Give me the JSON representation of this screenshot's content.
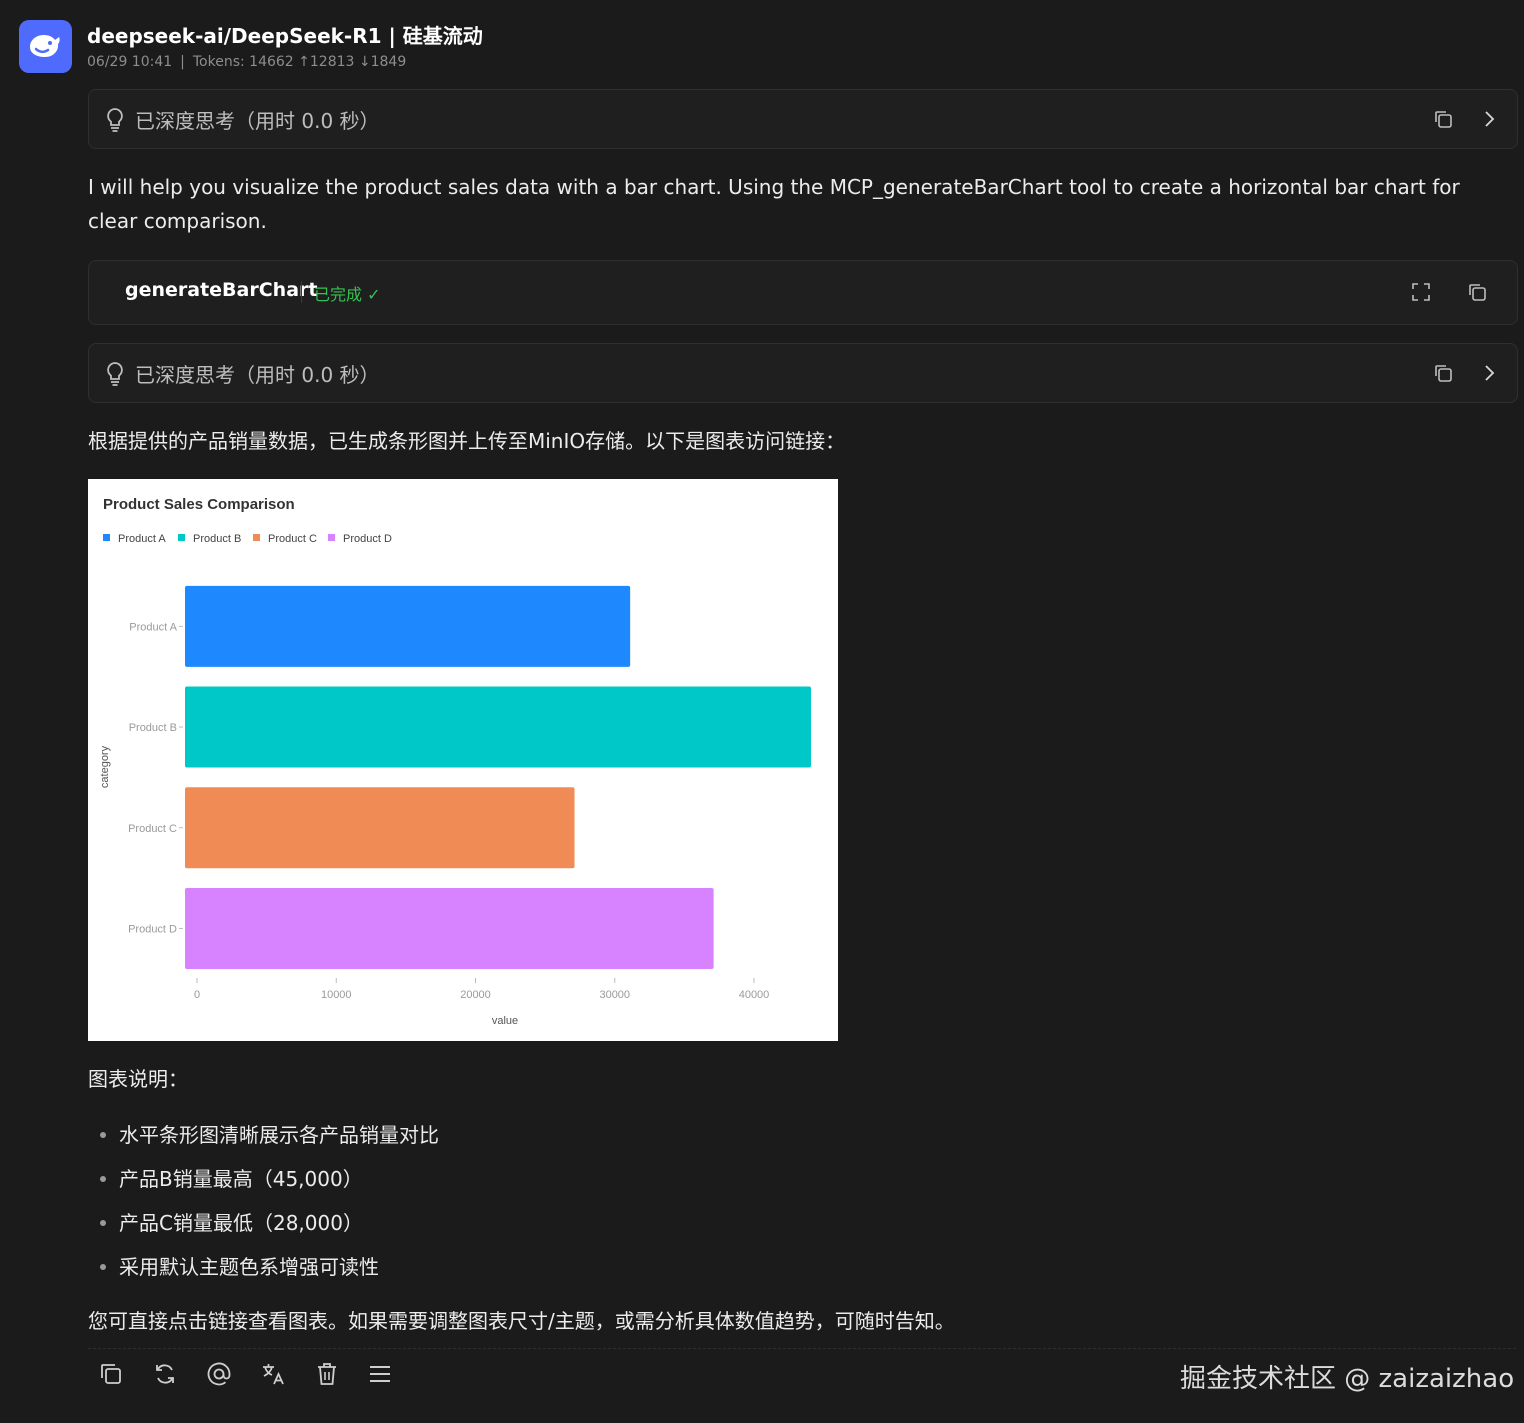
{
  "header": {
    "title": "deepseek-ai/DeepSeek-R1 | 硅基流动",
    "date": "06/29 10:41",
    "separator": "|",
    "tokens": "Tokens: 14662 ↑12813 ↓1849",
    "avatar_icon": "whale-logo-icon",
    "accent": "#4f6bfe"
  },
  "think1": {
    "label": "已深度思考（用时 0.0 秒）"
  },
  "intro_text": "I will help you visualize the product sales data with a bar chart. Using the MCP_generateBarChart tool to create a horizontal bar chart for clear comparison.",
  "tool": {
    "name": "generateBarChart",
    "status": "已完成 ✓",
    "status_color": "#36c251"
  },
  "think2": {
    "label": "已深度思考（用时 0.0 秒）"
  },
  "result_text": "根据提供的产品销量数据，已生成条形图并上传至MinIO存储。以下是图表访问链接：",
  "chart_data": {
    "type": "bar",
    "orientation": "horizontal",
    "title": "Product Sales Comparison",
    "xlabel": "value",
    "ylabel": "category",
    "categories": [
      "Product A",
      "Product B",
      "Product C",
      "Product D"
    ],
    "values": [
      32000,
      45000,
      28000,
      38000
    ],
    "colors": [
      "#1e88ff",
      "#00c8c8",
      "#f08b55",
      "#d783ff"
    ],
    "legend": [
      "Product A",
      "Product B",
      "Product C",
      "Product D"
    ],
    "legend_position": "top-left",
    "xticks": [
      "0",
      "10000",
      "20000",
      "30000",
      "40000"
    ],
    "xlim": [
      0,
      45000
    ],
    "grid": false
  },
  "notes_heading": "图表说明：",
  "bullets": [
    "水平条形图清晰展示各产品销量对比",
    "产品B销量最高（45,000）",
    "产品C销量最低（28,000）",
    "采用默认主题色系增强可读性"
  ],
  "closing_text": "您可直接点击链接查看图表。如果需要调整图表尺寸/主题，或需分析具体数值趋势，可随时告知。",
  "toolbar": {
    "icons": [
      "copy-icon",
      "refresh-icon",
      "mention-icon",
      "translate-icon",
      "delete-icon",
      "menu-icon"
    ]
  },
  "watermark": "掘金技术社区 @ zaizaizhao"
}
